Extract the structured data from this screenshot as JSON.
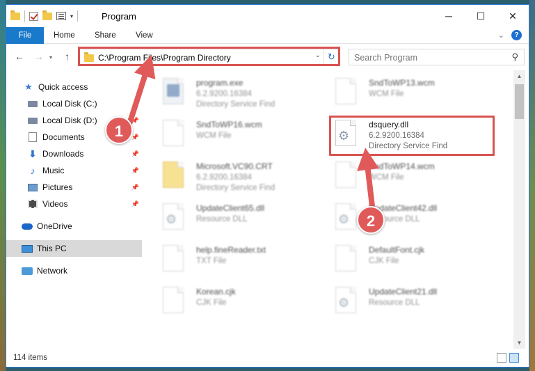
{
  "window": {
    "title": "Program",
    "controls": {
      "minimize": "─",
      "maximize": "☐",
      "close": "✕"
    }
  },
  "ribbon": {
    "tabs": [
      "File",
      "Home",
      "Share",
      "View"
    ],
    "help": "?"
  },
  "navbar": {
    "address": "C:\\Program Files\\Program Directory",
    "search_placeholder": "Search Program"
  },
  "sidebar": {
    "items": [
      {
        "label": "Quick access",
        "icon": "star-icon"
      },
      {
        "label": "Local Disk (C:)",
        "icon": "local-disk-icon"
      },
      {
        "label": "Local Disk (D:)",
        "icon": "local-disk-icon"
      },
      {
        "label": "Documents",
        "icon": "documents-icon"
      },
      {
        "label": "Downloads",
        "icon": "downloads-icon"
      },
      {
        "label": "Music",
        "icon": "music-icon"
      },
      {
        "label": "Pictures",
        "icon": "pictures-icon"
      },
      {
        "label": "Videos",
        "icon": "videos-icon"
      },
      {
        "label": "OneDrive",
        "icon": "onedrive-icon"
      },
      {
        "label": "This PC",
        "icon": "this-pc-icon"
      },
      {
        "label": "Network",
        "icon": "network-icon"
      }
    ]
  },
  "files": [
    {
      "name": "program.exe",
      "line1": "6.2.9200.16384",
      "line2": "Directory Service Find"
    },
    {
      "name": "SndToWP13.wcm",
      "line1": "WCM File",
      "line2": ""
    },
    {
      "name": "SndToWP16.wcm",
      "line1": "WCM File",
      "line2": ""
    },
    {
      "name": "dsquery.dll",
      "line1": "6.2.9200.16384",
      "line2": "Directory Service Find"
    },
    {
      "name": "Microsoft.VC90.CRT",
      "line1": "6.2.9200.16384",
      "line2": "Directory Service Find"
    },
    {
      "name": "SndToWP14.wcm",
      "line1": "WCM File",
      "line2": ""
    },
    {
      "name": "UpdateClient65.dll",
      "line1": "Resource DLL",
      "line2": ""
    },
    {
      "name": "UpdateClient42.dll",
      "line1": "Resource DLL",
      "line2": ""
    },
    {
      "name": "help.fineReader.txt",
      "line1": "TXT File",
      "line2": ""
    },
    {
      "name": "DefaultFont.cjk",
      "line1": "CJK File",
      "line2": ""
    },
    {
      "name": "Korean.cjk",
      "line1": "CJK File",
      "line2": ""
    },
    {
      "name": "UpdateClient21.dll",
      "line1": "Resource DLL",
      "line2": ""
    }
  ],
  "status": {
    "item_count": "114 items"
  },
  "annotations": {
    "badge1": "1",
    "badge2": "2",
    "color": "#e05a5a"
  }
}
